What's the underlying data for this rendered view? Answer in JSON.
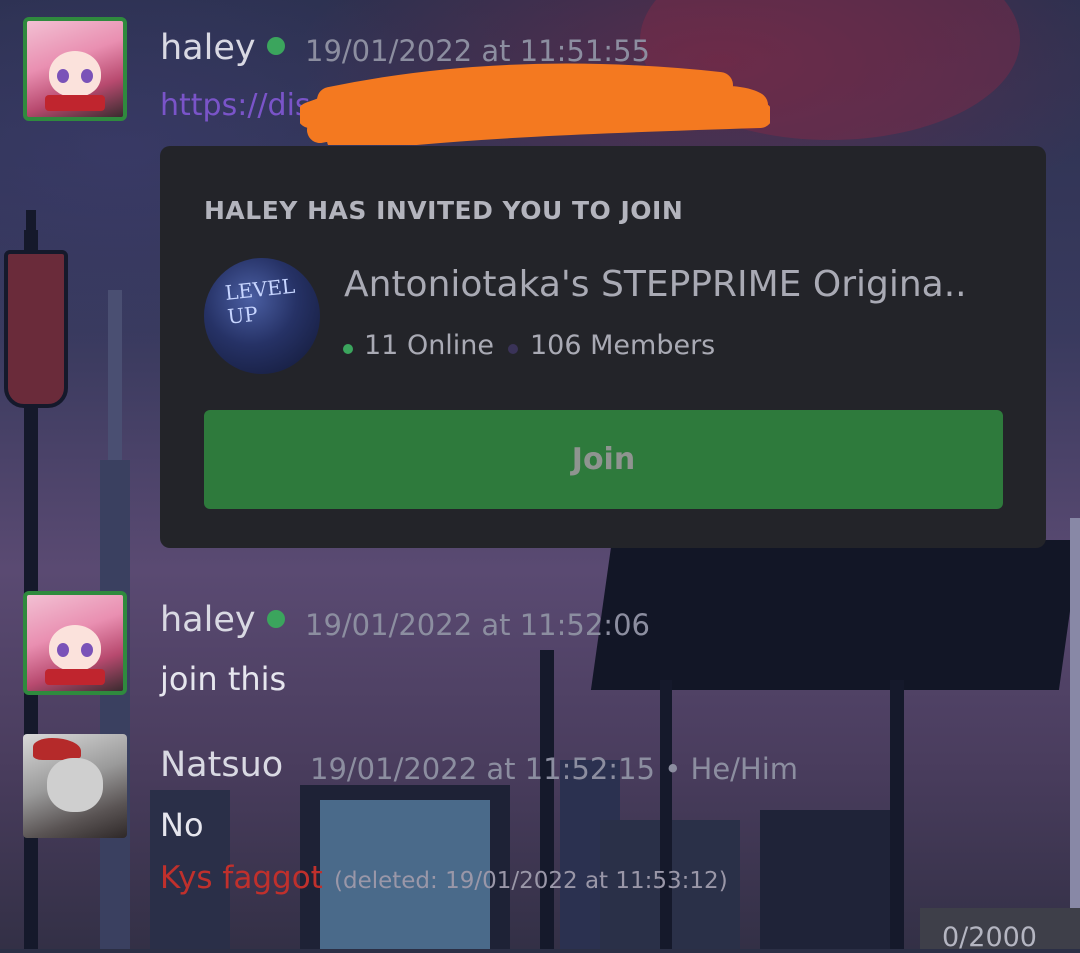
{
  "messages": [
    {
      "author": "haley",
      "timestamp": "19/01/2022 at 11:51:55",
      "link": "https://disc",
      "invite": {
        "heading": "HALEY HAS INVITED YOU TO JOIN",
        "server_name": "Antoniotaka's STEPPRIME Origina..",
        "icon_text": "LEVEL UP",
        "online": "11 Online",
        "members": "106 Members",
        "join_label": "Join",
        "colors": {
          "online_dot": "#3ba55d",
          "members_dot": "#3a3358",
          "join_button": "#2e7a3c"
        }
      }
    },
    {
      "author": "haley",
      "timestamp": "19/01/2022 at 11:52:06",
      "text": "join this"
    },
    {
      "author": "Natsuo",
      "timestamp": "19/01/2022 at 11:52:15 • He/Him",
      "text": "No",
      "deleted_text": "Kys faggot",
      "deleted_note": "(deleted: 19/01/2022 at 11:53:12)"
    }
  ],
  "composer": {
    "char_counter": "0/2000"
  },
  "colors": {
    "online_status": "#3ba55d",
    "link": "#7a54c9",
    "deleted_text": "#c0302c",
    "redaction_scribble": "#f47920"
  }
}
